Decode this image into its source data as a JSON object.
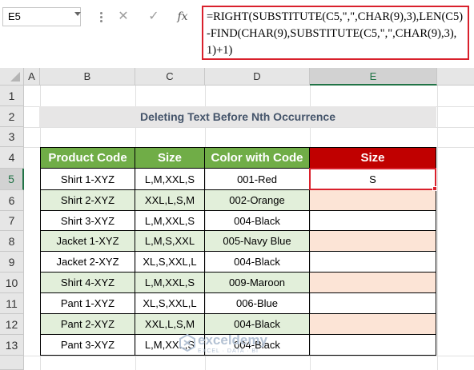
{
  "formula_bar": {
    "name_box": "E5",
    "cancel_icon": "✕",
    "enter_icon": "✓",
    "fx_label": "fx",
    "formula": "=RIGHT(SUBSTITUTE(C5,\",\",CHAR(9),3),LEN(C5)-FIND(CHAR(9),SUBSTITUTE(C5,\",\",CHAR(9),3),1)+1)"
  },
  "columns": [
    "A",
    "B",
    "C",
    "D",
    "E"
  ],
  "selected_column": "E",
  "rows": [
    "1",
    "2",
    "3",
    "4",
    "5",
    "6",
    "7",
    "8",
    "9",
    "10",
    "11",
    "12",
    "13"
  ],
  "selected_row": "5",
  "title": "Deleting Text Before Nth Occurrence",
  "table": {
    "headers": [
      "Product Code",
      "Size",
      "Color with Code",
      "Size"
    ],
    "rows": [
      {
        "product": "Shirt 1-XYZ",
        "size": "L,M,XXL,S",
        "color": "001-Red",
        "result": "S"
      },
      {
        "product": "Shirt 2-XYZ",
        "size": "XXL,L,S,M",
        "color": "002-Orange",
        "result": ""
      },
      {
        "product": "Shirt 3-XYZ",
        "size": "L,M,XXL,S",
        "color": "004-Black",
        "result": ""
      },
      {
        "product": "Jacket 1-XYZ",
        "size": "L,M,S,XXL",
        "color": "005-Navy Blue",
        "result": ""
      },
      {
        "product": "Jacket 2-XYZ",
        "size": "XL,S,XXL,L",
        "color": "004-Black",
        "result": ""
      },
      {
        "product": "Shirt 4-XYZ",
        "size": "L,M,XXL,S",
        "color": "009-Maroon",
        "result": ""
      },
      {
        "product": "Pant 1-XYZ",
        "size": "XL,S,XXL,L",
        "color": "006-Blue",
        "result": ""
      },
      {
        "product": "Pant 2-XYZ",
        "size": "XXL,L,S,M",
        "color": "004-Black",
        "result": ""
      },
      {
        "product": "Pant 3-XYZ",
        "size": "L,M,XXL,S",
        "color": "004-Black",
        "result": ""
      }
    ]
  },
  "watermark": {
    "name": "exceldemy",
    "tagline": "EXCEL · DATA · BI"
  },
  "colors": {
    "header_green": "#70ad47",
    "header_red": "#c00000",
    "band_green": "#e2efda",
    "band_salmon": "#fce4d6",
    "selection_red": "#d9202c",
    "title_fill": "#e7e6e6",
    "title_text": "#44546a"
  }
}
